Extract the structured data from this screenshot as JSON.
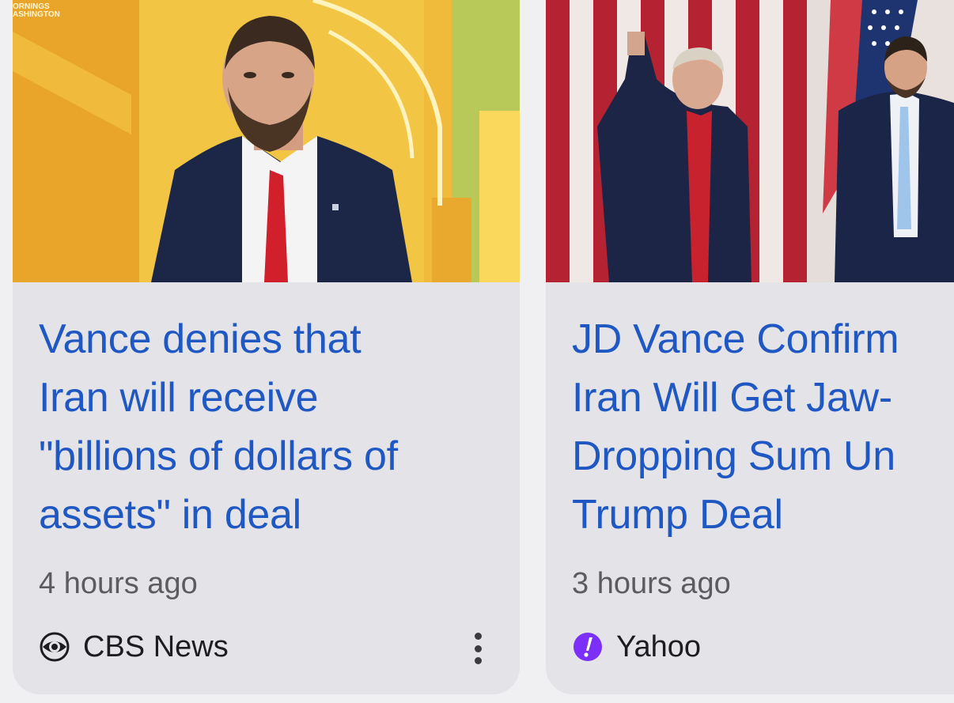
{
  "cards": [
    {
      "headline_lines": [
        "Vance denies that",
        "Iran will receive",
        "\"billions of dollars of",
        "assets\" in deal"
      ],
      "time": "4 hours ago",
      "source": "CBS News",
      "source_icon": "cbs-eye-icon",
      "thumbnail_text": [
        "ORNINGS",
        "ASHINGTON"
      ],
      "more_icon": "more-vert-icon"
    },
    {
      "headline_lines": [
        "JD Vance Confirm",
        "Iran Will Get Jaw-",
        "Dropping Sum Un",
        "Trump Deal"
      ],
      "time": "3 hours ago",
      "source": "Yahoo",
      "source_icon": "yahoo-exclamation-icon",
      "accent_color": "#7b2ff7"
    }
  ],
  "colors": {
    "headline": "#1f57c3",
    "card_bg": "#e3e3e8",
    "page_bg": "#f0f0f2"
  }
}
